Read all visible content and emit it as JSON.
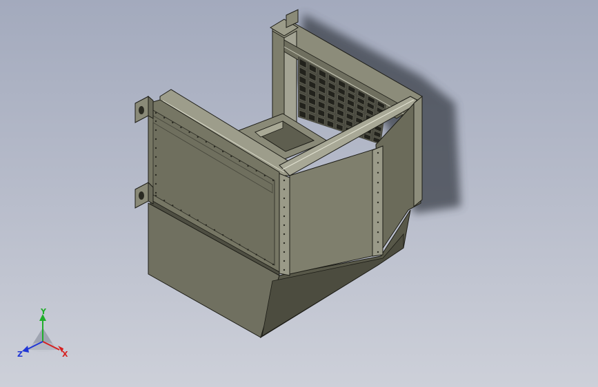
{
  "triad": {
    "x_label": "X",
    "y_label": "Y",
    "z_label": "Z",
    "colors": {
      "x": "#d62020",
      "y": "#1fae2a",
      "z": "#2036d6"
    }
  },
  "model": {
    "body_color": "#707060",
    "grid": {
      "rows": 7,
      "cols": 9
    },
    "mounting_brackets": 3
  }
}
